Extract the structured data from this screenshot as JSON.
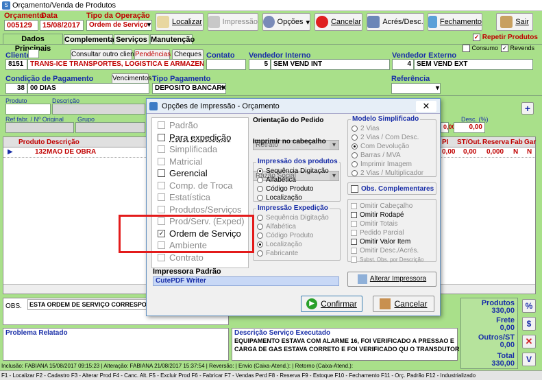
{
  "window": {
    "title": "Orçamento/Venda de Produtos"
  },
  "header": {
    "orc_label": "Orçamento",
    "orc_value": "005129",
    "data_label": "Data",
    "data_value": "15/08/2017",
    "tipo_label": "Tipo da Operação",
    "tipo_value": "Ordem de Serviço"
  },
  "toolbar": {
    "localizar": "Localizar",
    "impressao": "Impressão",
    "opcoes": "Opções",
    "cancelar": "Cancelar",
    "acres": "Acrés/Desc.",
    "fechamento": "Fechamento",
    "sair": "Sair"
  },
  "tabs": [
    "Dados Principais",
    "Complementar",
    "Serviços",
    "Manutenção"
  ],
  "flags": {
    "repetir": "Repetir Produtos",
    "consumo": "Consumo",
    "revends": "Revends"
  },
  "cliente": {
    "label": "Cliente",
    "consultar": "Consultar outro cliente",
    "pendencias": "Pendências",
    "cheques": "Cheques",
    "code": "8151",
    "name": "TRANS-ICE TRANSPORTES, LOGISTICA E ARMAZENAGENS LT",
    "contato": "Contato"
  },
  "vend_int": {
    "label": "Vendedor Interno",
    "code": "5",
    "name": "SEM VEND INT"
  },
  "vend_ext": {
    "label": "Vendedor Externo",
    "code": "4",
    "name": "SEM VEND EXT"
  },
  "pagto": {
    "cond_label": "Condição de Pagamento",
    "venc": "Vencimentos",
    "cond_code": "38",
    "cond_name": "00 DIAS",
    "tipo_label": "Tipo Pagamento",
    "tipo_value": "DEPOSITO BANCARIO",
    "ref_label": "Referência"
  },
  "prod_labels": {
    "produto": "Produto",
    "descricao": "Descrição",
    "ref": "Ref fabr. / Nº Original",
    "grupo": "Grupo",
    "desc_pct": "Desc. (%)",
    "desc_val": "0,00",
    "desc_val2": "0,00"
  },
  "grid": {
    "headers": [
      "Produto",
      "Descrição"
    ],
    "right_headers": [
      "PI",
      "ST/Out.",
      "Reserva",
      "Fab",
      "Gar"
    ],
    "row": {
      "code": "132",
      "desc": "MAO DE OBRA",
      "pi": "0,00",
      "st": "0,00",
      "reserva": "0,000",
      "fab": "N",
      "gar": "N"
    }
  },
  "obs": {
    "label": "OBS.",
    "text": "ESTA ORDEM DE SERVIÇO CORRESPONDE"
  },
  "problema": {
    "label": "Problema Relatado"
  },
  "servico": {
    "label": "Descrição Serviço Executado",
    "line1": "EQUIPAMENTO ESTAVA COM ALARME 16, FOI VERIFICADO A PRESSAO E",
    "line2": "CARGA DE GAS ESTAVA CORRETO E FOI VERIFICADO QU O TRANSDUTOR"
  },
  "totais": {
    "produtos_l": "Produtos",
    "produtos_v": "330,00",
    "frete_l": "Frete",
    "frete_v": "0,00",
    "outros_l": "Outros/ST",
    "outros_v": "0,00",
    "total_l": "Total",
    "total_v": "330,00"
  },
  "status": "Inclusão: FABIANA 15/08/2017 09:15:23 | Alteração: FABIANA 21/08/2017 15:37:54 | Reversão: | Envio (Caixa-Atend.): | Retorno (Caixa-Atend.):",
  "fkeys": "F1 - Localizar  F2 - Cadastro  F3 - Alterar Prod  F4 - Canc. Alt.  F5 - Excluir Prod  F6 - Fabricar  F7 - Vendas Perd  F8 - Reserva  F9 - Estoque  F10 - Fechamento  F11 - Orç. Padrão  F12 - Industrializado",
  "dialog": {
    "title": "Opções de Impressão - Orçamento",
    "options": [
      {
        "label": "Padrão",
        "checked": false,
        "enabled": false
      },
      {
        "label": "Para expedição",
        "checked": false,
        "enabled": true
      },
      {
        "label": "Simplificada",
        "checked": false,
        "enabled": false
      },
      {
        "label": "Matricial",
        "checked": false,
        "enabled": false
      },
      {
        "label": "Gerencial",
        "checked": false,
        "enabled": true
      },
      {
        "label": "Comp. de Troca",
        "checked": false,
        "enabled": false
      },
      {
        "label": "Estatística",
        "checked": false,
        "enabled": false
      },
      {
        "label": "Produtos/Serviços",
        "checked": false,
        "enabled": false
      },
      {
        "label": "Prod/Serv. (Exped)",
        "checked": false,
        "enabled": false
      },
      {
        "label": "Ordem de Serviço",
        "checked": true,
        "enabled": true
      },
      {
        "label": "Ambiente",
        "checked": false,
        "enabled": false
      },
      {
        "label": "Contrato",
        "checked": false,
        "enabled": false
      }
    ],
    "orient_label": "Orientação do Pedido",
    "orient_value": "Retrato",
    "imprimir_label": "Imprimir no cabeçalho",
    "imprimir_value": "Razão Social",
    "imp_prod_label": "Impressão dos produtos",
    "imp_prod": [
      "Sequência Digitação",
      "Alfabética",
      "Código Produto",
      "Localização"
    ],
    "imp_exp_label": "Impressão Expedição",
    "imp_exp": [
      "Sequência Digitação",
      "Alfabética",
      "Código Produto",
      "Localização",
      "Fabricante"
    ],
    "modelo_label": "Modelo Simplificado",
    "modelo": [
      "2 Vias",
      "2 Vias / Com Desc.",
      "Com Devolução",
      "Barras / MVA",
      "Imprimir Imagem",
      "2 Vias / Multiplicador"
    ],
    "obs_compl": "Obs. Complementares",
    "omit": [
      "Omitir Cabeçalho",
      "Omitir Rodapé",
      "Omitir Totais",
      "Pedido Parcial",
      "Omitir Valor Item",
      "Omitir Desc./Acrés.",
      "Subst. Obs. por Descrição"
    ],
    "impressora_label": "Impressora Padrão",
    "impressora_value": "CutePDF Writer",
    "alterar": "Alterar Impressora",
    "confirmar": "Confirmar",
    "cancelar": "Cancelar"
  },
  "colors": {
    "bg": "#a9e08a",
    "highlight": "#e31b1b",
    "accent": "#1a2fa8"
  }
}
